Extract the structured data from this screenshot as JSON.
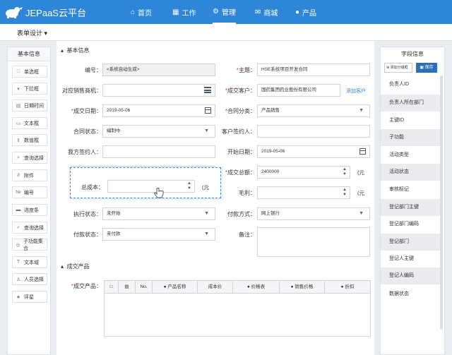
{
  "app": {
    "title": "JEPaaS云平台"
  },
  "nav": [
    {
      "label": "首页",
      "icon": "home-icon"
    },
    {
      "label": "工作",
      "icon": "grid-icon"
    },
    {
      "label": "管理",
      "icon": "gear-icon"
    },
    {
      "label": "商城",
      "icon": "mail-icon"
    },
    {
      "label": "产品",
      "icon": "product-icon"
    }
  ],
  "subbar": {
    "title": "表单设计"
  },
  "left_panel": {
    "title": "基本信息",
    "items": [
      "单选框",
      "下拉框",
      "日期时间",
      "文本框",
      "数值框",
      "查询选择",
      "附件",
      "编号",
      "进度条",
      "查询选择",
      "子功能集合",
      "文本域",
      "人员选择",
      "评星"
    ]
  },
  "main": {
    "section_basic": "基本信息",
    "section_product": "成交产品",
    "labels": {
      "bianhao": "编号：",
      "zhuti": "主题：",
      "duiying": "对应销售商机：",
      "kehu": "成交客户：",
      "riqi": "成交日期：",
      "fenlei": "合同分类：",
      "zhuangtai": "合同状态：",
      "kehu_qy": "客户签约人：",
      "wofang": "我方签约人：",
      "kaishi": "开始日期：",
      "zongjia": "成交总额：",
      "chengben": "总成本：",
      "maoli": "毛利：",
      "zhixing": "执行状态：",
      "fukuan_fs": "付款方式：",
      "fukuan_zt": "付款状态：",
      "beizhu": "备注：",
      "chanpin": "成交产品："
    },
    "values": {
      "bianhao": "<系统自动生成>",
      "zhuti": "HSE系统项目开发合同",
      "kehu": "国药集团药业股份有限公司",
      "riqi": "2019-05-06",
      "fenlei": "产品销售",
      "zhuangtai": "编制中",
      "kaishi": "2019-05-06",
      "zongjia": "2400000",
      "zhixing": "未开始",
      "fukuan_fs": "网上银行",
      "fukuan_zt": "未付款"
    },
    "unit": "(元",
    "add_customer": "添加客户",
    "table_headers": [
      "No.",
      "● 产品名称",
      "成本价",
      "● 价格表",
      "● 销售价格",
      "● 折扣"
    ]
  },
  "right_panel": {
    "title": "字段信息",
    "add_btn": "添加分组框",
    "save_btn": "保存",
    "fields": [
      "负责人ID",
      "负责人所在部门",
      "主键ID",
      "子功能",
      "活动类型",
      "活动状态",
      "审核标记",
      "登记部门主键",
      "登记部门编码",
      "登记部门",
      "登记人主键",
      "登记人编码",
      "数据状态"
    ]
  },
  "colors": {
    "brand": "#2e86d8",
    "required": "#e04040",
    "save": "#2c6fb7"
  }
}
